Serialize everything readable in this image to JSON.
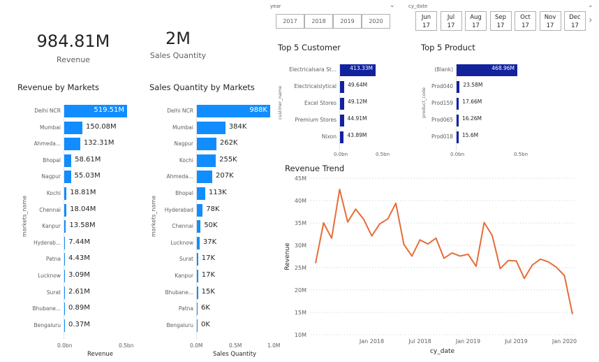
{
  "kpis": {
    "revenue": {
      "value": "984.81M",
      "label": "Revenue"
    },
    "sales_qty": {
      "value": "2M",
      "label": "Sales Quantity"
    }
  },
  "slicers": {
    "year": {
      "title": "year",
      "options": [
        "2017",
        "2018",
        "2019",
        "2020"
      ]
    },
    "cy_date": {
      "title": "cy_date",
      "months": [
        {
          "m": "Jun",
          "y": "17"
        },
        {
          "m": "Jul",
          "y": "17"
        },
        {
          "m": "Aug",
          "y": "17"
        },
        {
          "m": "Sep",
          "y": "17"
        },
        {
          "m": "Oct",
          "y": "17"
        },
        {
          "m": "Nov",
          "y": "17"
        },
        {
          "m": "Dec",
          "y": "17"
        }
      ],
      "next_icon": "chevron-right-icon"
    }
  },
  "colors": {
    "bar": "#118dff",
    "top5": "#12239e",
    "trend": "#e66c37"
  },
  "revenue_by_markets": {
    "title": "Revenue by Markets",
    "ylabel": "markets_name",
    "xlabel": "Revenue",
    "ticks": [
      "0.0bn",
      "0.5bn"
    ],
    "max": 519.51,
    "rows": [
      {
        "name": "Delhi NCR",
        "value": 519.51,
        "label": "519.51M"
      },
      {
        "name": "Mumbai",
        "value": 150.08,
        "label": "150.08M"
      },
      {
        "name": "Ahmeda...",
        "value": 132.31,
        "label": "132.31M"
      },
      {
        "name": "Bhopal",
        "value": 58.61,
        "label": "58.61M"
      },
      {
        "name": "Nagpur",
        "value": 55.03,
        "label": "55.03M"
      },
      {
        "name": "Kochi",
        "value": 18.81,
        "label": "18.81M"
      },
      {
        "name": "Chennai",
        "value": 18.04,
        "label": "18.04M"
      },
      {
        "name": "Kanpur",
        "value": 13.58,
        "label": "13.58M"
      },
      {
        "name": "Hyderab...",
        "value": 7.44,
        "label": "7.44M"
      },
      {
        "name": "Patna",
        "value": 4.43,
        "label": "4.43M"
      },
      {
        "name": "Lucknow",
        "value": 3.09,
        "label": "3.09M"
      },
      {
        "name": "Surat",
        "value": 2.61,
        "label": "2.61M"
      },
      {
        "name": "Bhubane...",
        "value": 0.89,
        "label": "0.89M"
      },
      {
        "name": "Bengaluru",
        "value": 0.37,
        "label": "0.37M"
      }
    ]
  },
  "qty_by_markets": {
    "title": "Sales Quantity by Markets",
    "ylabel": "markets_name",
    "xlabel": "Sales Quantity",
    "ticks": [
      "0.0M",
      "0.5M",
      "1.0M"
    ],
    "max": 988,
    "rows": [
      {
        "name": "Delhi NCR",
        "value": 988,
        "label": "988K"
      },
      {
        "name": "Mumbai",
        "value": 384,
        "label": "384K"
      },
      {
        "name": "Nagpur",
        "value": 262,
        "label": "262K"
      },
      {
        "name": "Kochi",
        "value": 255,
        "label": "255K"
      },
      {
        "name": "Ahmeda...",
        "value": 207,
        "label": "207K"
      },
      {
        "name": "Bhopal",
        "value": 113,
        "label": "113K"
      },
      {
        "name": "Hyderabad",
        "value": 78,
        "label": "78K"
      },
      {
        "name": "Chennai",
        "value": 50,
        "label": "50K"
      },
      {
        "name": "Lucknow",
        "value": 37,
        "label": "37K"
      },
      {
        "name": "Surat",
        "value": 17,
        "label": "17K"
      },
      {
        "name": "Kanpur",
        "value": 17,
        "label": "17K"
      },
      {
        "name": "Bhubane...",
        "value": 15,
        "label": "15K"
      },
      {
        "name": "Patna",
        "value": 6,
        "label": "6K"
      },
      {
        "name": "Bengaluru",
        "value": 0,
        "label": "0K"
      }
    ]
  },
  "top5_customer": {
    "title": "Top 5 Customer",
    "ylabel": "custmer_name",
    "ticks": [
      "0.0bn",
      "0.5bn"
    ],
    "rows": [
      {
        "name": "Electricalsara St...",
        "value": 413.33,
        "label": "413.33M"
      },
      {
        "name": "Electricalslytical",
        "value": 49.64,
        "label": "49.64M"
      },
      {
        "name": "Excel Stores",
        "value": 49.12,
        "label": "49.12M"
      },
      {
        "name": "Premium Stores",
        "value": 44.91,
        "label": "44.91M"
      },
      {
        "name": "Nixon",
        "value": 43.89,
        "label": "43.89M"
      }
    ]
  },
  "top5_product": {
    "title": "Top 5 Product",
    "ylabel": "product_code",
    "ticks": [
      "0.0bn",
      "0.5bn"
    ],
    "rows": [
      {
        "name": "(Blank)",
        "value": 468.96,
        "label": "468.96M"
      },
      {
        "name": "Prod040",
        "value": 23.58,
        "label": "23.58M"
      },
      {
        "name": "Prod159",
        "value": 17.66,
        "label": "17.66M"
      },
      {
        "name": "Prod065",
        "value": 16.26,
        "label": "16.26M"
      },
      {
        "name": "Prod018",
        "value": 15.6,
        "label": "15.6M"
      }
    ]
  },
  "chart_data": {
    "type": "line",
    "title": "Revenue Trend",
    "xlabel": "cy_date",
    "ylabel": "Revenue",
    "ylim": [
      10,
      45
    ],
    "y_ticks": [
      "45M",
      "40M",
      "35M",
      "30M",
      "25M",
      "20M",
      "15M",
      "10M"
    ],
    "x_ticks": [
      "Jan 2018",
      "Jul 2018",
      "Jan 2019",
      "Jul 2019",
      "Jan 2020"
    ],
    "grid": true,
    "series": [
      {
        "values": [
          26,
          35,
          31.6,
          42.5,
          35.2,
          38.1,
          35.8,
          32.1,
          34.8,
          35.9,
          39.4,
          30.2,
          27.6,
          31.2,
          30.3,
          31.6,
          27.1,
          28.3,
          27.6,
          28.0,
          25.3,
          35.1,
          32.2,
          24.8,
          26.6,
          26.5,
          22.6,
          25.6,
          26.9,
          26.3,
          25.1,
          23.2,
          14.6
        ]
      }
    ]
  }
}
